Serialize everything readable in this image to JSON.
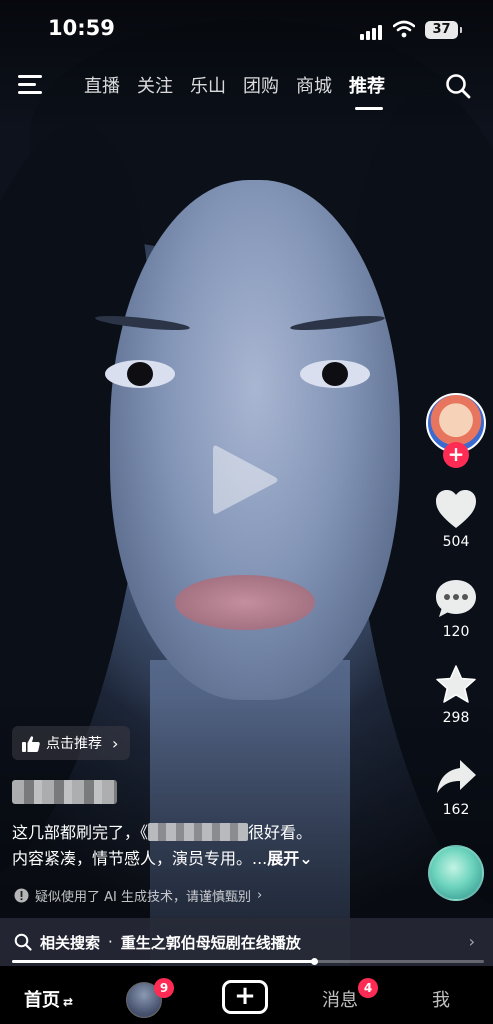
{
  "status_bar": {
    "time": "10:59",
    "battery": "37"
  },
  "top_nav": {
    "tabs": [
      {
        "label": "直播",
        "active": false
      },
      {
        "label": "关注",
        "active": false
      },
      {
        "label": "乐山",
        "active": false
      },
      {
        "label": "团购",
        "active": false
      },
      {
        "label": "商城",
        "active": false
      },
      {
        "label": "推荐",
        "active": true
      }
    ]
  },
  "right_rail": {
    "likes": "504",
    "comments": "120",
    "favorites": "298",
    "shares": "162",
    "follow_symbol": "+"
  },
  "video_info": {
    "recommend_label": "点击推荐",
    "description_line1_a": "这几部都刷完了，《",
    "description_line1_b": "很好看。",
    "description_line2": "内容紧凑，情节感人，演员专用。...",
    "expand_label": "展开",
    "ai_notice": "疑似使用了 AI 生成技术，请谨慎甄别",
    "progress_fraction": 0.64
  },
  "related_search": {
    "label": "相关搜索",
    "separator": "·",
    "query": "重生之郭伯母短剧在线播放"
  },
  "tab_bar": {
    "home": "首页",
    "friends_badge": "9",
    "create": "+",
    "messages": "消息",
    "messages_badge": "4",
    "me": "我"
  },
  "colors": {
    "accent": "#fe2c55"
  },
  "icons": [
    "menu-icon",
    "search-icon",
    "play-icon",
    "heart-icon",
    "comment-icon",
    "star-icon",
    "share-icon",
    "thumbs-up-icon",
    "warning-icon",
    "plus-icon"
  ]
}
